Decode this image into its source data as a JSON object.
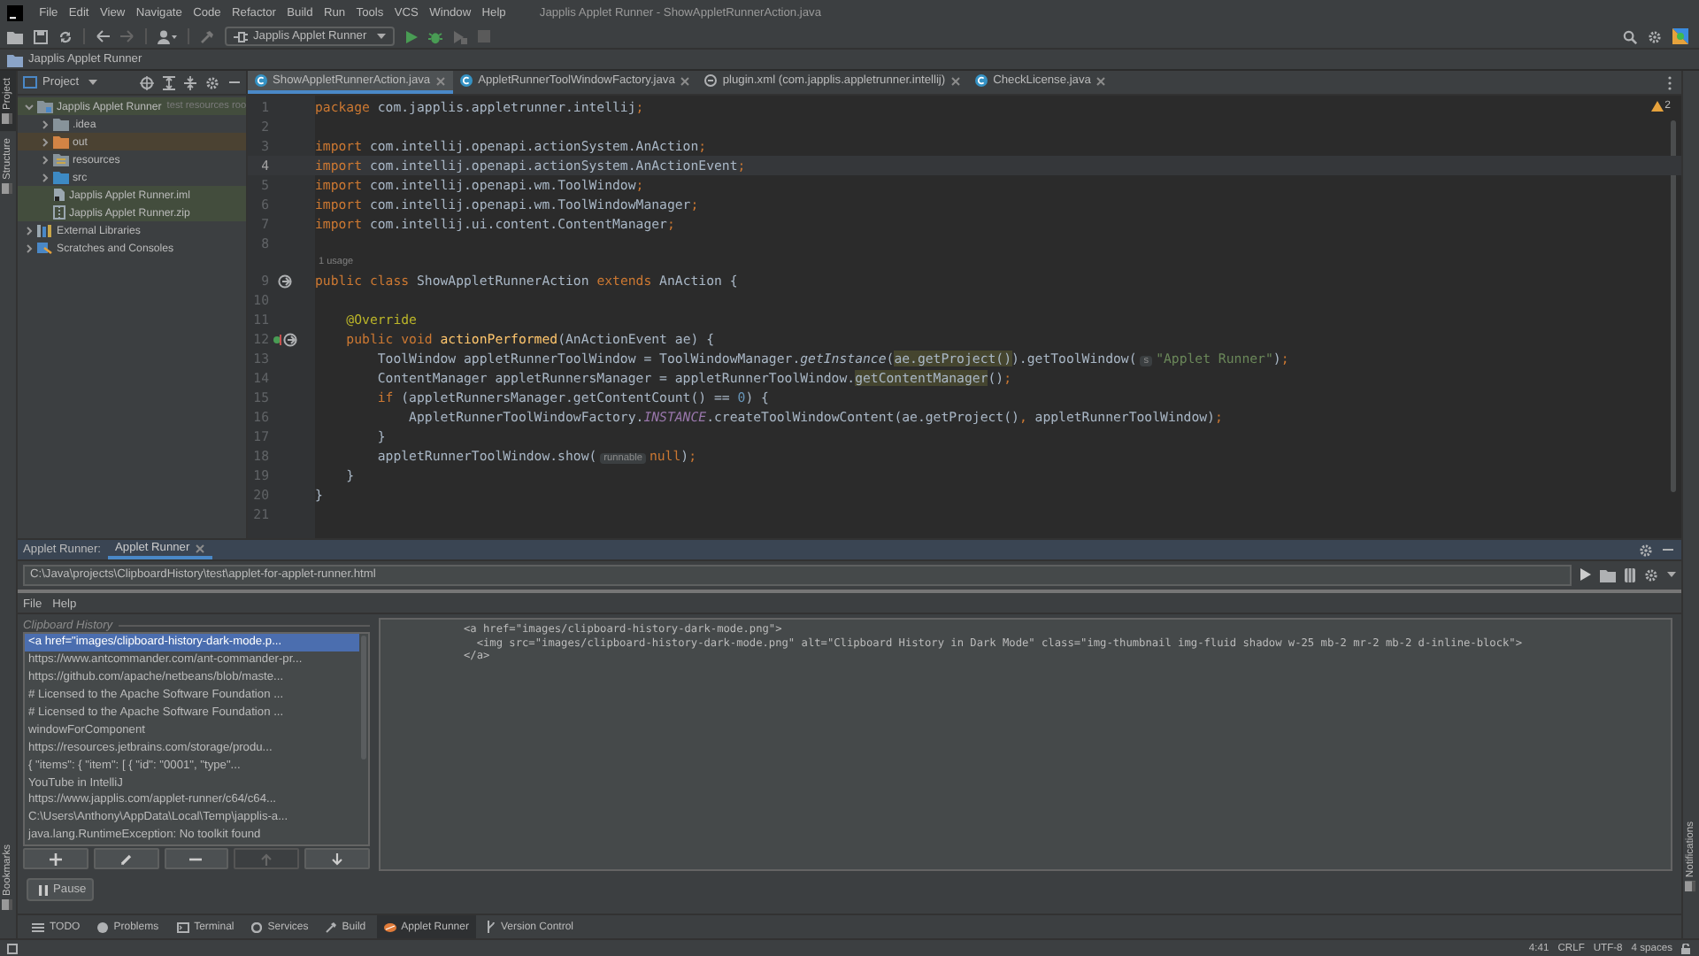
{
  "window": {
    "title": "Japplis Applet Runner - ShowAppletRunnerAction.java"
  },
  "menu": [
    "File",
    "Edit",
    "View",
    "Navigate",
    "Code",
    "Refactor",
    "Build",
    "Run",
    "Tools",
    "VCS",
    "Window",
    "Help"
  ],
  "toolbar": {
    "run_configuration": "Japplis Applet Runner"
  },
  "breadcrumb": "Japplis Applet Runner",
  "tool_stripe": {
    "left_top": [
      {
        "label": "Project",
        "selected": true
      },
      {
        "label": "Structure",
        "selected": false
      }
    ],
    "left_bottom": [
      {
        "label": "Bookmarks",
        "selected": false
      }
    ],
    "right_bottom": [
      {
        "label": "Notifications",
        "selected": false
      }
    ]
  },
  "project": {
    "title": "Project",
    "tree": [
      {
        "label": "Japplis Applet Runner",
        "note": "test resources roo",
        "kind": "module",
        "expanded": true,
        "color": "#434d3d",
        "children": [
          {
            "label": ".idea",
            "kind": "folder",
            "expanded": false
          },
          {
            "label": "out",
            "kind": "excluded-folder",
            "expanded": false,
            "color": "#4b4232"
          },
          {
            "label": "resources",
            "kind": "resources-folder",
            "expanded": false
          },
          {
            "label": "src",
            "kind": "source-folder",
            "expanded": false
          },
          {
            "label": "Japplis Applet Runner.iml",
            "kind": "iml-file",
            "color": "#434d3d"
          },
          {
            "label": "Japplis Applet Runner.zip",
            "kind": "zip-file",
            "color": "#434d3d"
          }
        ]
      },
      {
        "label": "External Libraries",
        "kind": "libraries",
        "expanded": false
      },
      {
        "label": "Scratches and Consoles",
        "kind": "scratches",
        "expanded": false
      }
    ]
  },
  "editor": {
    "tabs": [
      {
        "label": "ShowAppletRunnerAction.java",
        "kind": "java",
        "selected": true
      },
      {
        "label": "AppletRunnerToolWindowFactory.java",
        "kind": "java",
        "selected": false
      },
      {
        "label": "plugin.xml (com.japplis.appletrunner.intellij)",
        "kind": "xml",
        "selected": false
      },
      {
        "label": "CheckLicense.java",
        "kind": "java",
        "selected": false
      }
    ],
    "warning_count": "2",
    "lines": [
      {
        "number": "1",
        "kind": "code",
        "current": false,
        "tokens": [
          {
            "kind": "keyword",
            "text": "package"
          },
          {
            "kind": "plain",
            "text": " com.japplis.appletrunner.intellij"
          },
          {
            "kind": "keyword",
            "text": ";"
          }
        ]
      },
      {
        "number": "2",
        "kind": "code",
        "current": false
      },
      {
        "number": "3",
        "kind": "code",
        "current": false,
        "tokens": [
          {
            "kind": "keyword",
            "text": "import"
          },
          {
            "kind": "plain",
            "text": " com.intellij.openapi.actionSystem.AnAction"
          },
          {
            "kind": "keyword",
            "text": ";"
          }
        ]
      },
      {
        "number": "4",
        "kind": "code",
        "current": true,
        "tokens": [
          {
            "kind": "keyword",
            "text": "import"
          },
          {
            "kind": "plain",
            "text": " com.intellij.openapi.actionSystem.AnActionEvent"
          },
          {
            "kind": "keyword",
            "text": ";"
          }
        ]
      },
      {
        "number": "5",
        "kind": "code",
        "current": false,
        "tokens": [
          {
            "kind": "keyword",
            "text": "import"
          },
          {
            "kind": "plain",
            "text": " com.intellij.openapi.wm.ToolWindow"
          },
          {
            "kind": "keyword",
            "text": ";"
          }
        ]
      },
      {
        "number": "6",
        "kind": "code",
        "current": false,
        "tokens": [
          {
            "kind": "keyword",
            "text": "import"
          },
          {
            "kind": "plain",
            "text": " com.intellij.openapi.wm.ToolWindowManager"
          },
          {
            "kind": "keyword",
            "text": ";"
          }
        ]
      },
      {
        "number": "7",
        "kind": "code",
        "current": false,
        "tokens": [
          {
            "kind": "keyword",
            "text": "import"
          },
          {
            "kind": "plain",
            "text": " com.intellij.ui.content.ContentManager"
          },
          {
            "kind": "keyword",
            "text": ";"
          }
        ]
      },
      {
        "number": "8",
        "kind": "code",
        "current": false
      },
      {
        "number": "9",
        "kind": "class-declaration",
        "current": false,
        "usage": "1 usage",
        "tokens": [
          {
            "kind": "keyword",
            "text": "public class"
          },
          {
            "kind": "plain",
            "text": " ShowAppletRunnerAction "
          },
          {
            "kind": "keyword",
            "text": "extends"
          },
          {
            "kind": "plain",
            "text": " AnAction {"
          }
        ]
      },
      {
        "number": "10",
        "kind": "code",
        "current": false
      },
      {
        "number": "11",
        "kind": "code",
        "current": false,
        "tokens": [
          {
            "kind": "annotation",
            "text": "    @Override"
          }
        ]
      },
      {
        "number": "12",
        "kind": "override-method",
        "current": false,
        "tokens": [
          {
            "kind": "keyword",
            "text": "    public void "
          },
          {
            "kind": "method",
            "text": "actionPerformed"
          },
          {
            "kind": "plain",
            "text": "(AnActionEvent ae) {"
          }
        ]
      },
      {
        "number": "13",
        "kind": "code",
        "current": false,
        "tokens": [
          {
            "kind": "plain",
            "text": "        ToolWindow appletRunnerToolWindow = ToolWindowManager."
          },
          {
            "kind": "static",
            "text": "getInstance"
          },
          {
            "kind": "plain",
            "text": "("
          },
          {
            "kind": "usage",
            "text": "ae.getProject()"
          },
          {
            "kind": "plain",
            "text": ").getToolWindow("
          },
          {
            "kind": "hint",
            "text": "s"
          },
          {
            "kind": "string",
            "text": "\"Applet Runner\""
          },
          {
            "kind": "plain",
            "text": ")"
          },
          {
            "kind": "keyword",
            "text": ";"
          }
        ]
      },
      {
        "number": "14",
        "kind": "code",
        "current": false,
        "tokens": [
          {
            "kind": "plain",
            "text": "        ContentManager appletRunnersManager = appletRunnerToolWindow."
          },
          {
            "kind": "usage",
            "text": "getContentManager"
          },
          {
            "kind": "plain",
            "text": "()"
          },
          {
            "kind": "keyword",
            "text": ";"
          }
        ]
      },
      {
        "number": "15",
        "kind": "code",
        "current": false,
        "tokens": [
          {
            "kind": "keyword",
            "text": "        if"
          },
          {
            "kind": "plain",
            "text": " (appletRunnersManager.getContentCount() == "
          },
          {
            "kind": "number",
            "text": "0"
          },
          {
            "kind": "plain",
            "text": ") {"
          }
        ]
      },
      {
        "number": "16",
        "kind": "code",
        "current": false,
        "tokens": [
          {
            "kind": "plain",
            "text": "            AppletRunnerToolWindowFactory."
          },
          {
            "kind": "constant",
            "text": "INSTANCE"
          },
          {
            "kind": "plain",
            "text": ".createToolWindowContent(ae.getProject()"
          },
          {
            "kind": "keyword",
            "text": ","
          },
          {
            "kind": "plain",
            "text": " appletRunnerToolWindow)"
          },
          {
            "kind": "keyword",
            "text": ";"
          }
        ]
      },
      {
        "number": "17",
        "kind": "code",
        "current": false,
        "tokens": [
          {
            "kind": "plain",
            "text": "        }"
          }
        ]
      },
      {
        "number": "18",
        "kind": "code",
        "current": false,
        "tokens": [
          {
            "kind": "plain",
            "text": "        appletRunnerToolWindow.show("
          },
          {
            "kind": "hint",
            "text": "runnable"
          },
          {
            "kind": "keyword",
            "text": "null"
          },
          {
            "kind": "plain",
            "text": ")"
          },
          {
            "kind": "keyword",
            "text": ";"
          }
        ]
      },
      {
        "number": "19",
        "kind": "code",
        "current": false,
        "tokens": [
          {
            "kind": "plain",
            "text": "    }"
          }
        ]
      },
      {
        "number": "20",
        "kind": "code",
        "current": false,
        "tokens": [
          {
            "kind": "plain",
            "text": "}"
          }
        ]
      },
      {
        "number": "21",
        "kind": "code",
        "current": false
      }
    ]
  },
  "applet_runner": {
    "title": "Applet Runner:",
    "tabs": [
      {
        "label": "Applet Runner",
        "selected": true
      }
    ],
    "path": "C:\\Java\\projects\\ClipboardHistory\\test\\applet-for-applet-runner.html",
    "menu": [
      "File",
      "Help"
    ],
    "history_title": "Clipboard History",
    "history": [
      {
        "text": "<a href=\"images/clipboard-history-dark-mode.p...",
        "selected": true
      },
      {
        "text": "https://www.antcommander.com/ant-commander-pr...",
        "selected": false
      },
      {
        "text": "https://github.com/apache/netbeans/blob/maste...",
        "selected": false
      },
      {
        "text": "# Licensed to the Apache Software Foundation ...",
        "selected": false
      },
      {
        "text": "# Licensed to the Apache Software Foundation ...",
        "selected": false
      },
      {
        "text": "windowForComponent",
        "selected": false
      },
      {
        "text": "https://resources.jetbrains.com/storage/produ...",
        "selected": false
      },
      {
        "text": "{ \"items\": { \"item\": [ { \"id\": \"0001\", \"type\"...",
        "selected": false
      },
      {
        "text": "YouTube in IntelliJ",
        "selected": false
      },
      {
        "text": "https://www.japplis.com/applet-runner/c64/c64...",
        "selected": false
      },
      {
        "text": "C:\\Users\\Anthony\\AppData\\Local\\Temp\\japplis-a...",
        "selected": false
      },
      {
        "text": "java.lang.RuntimeException: No toolkit found",
        "selected": false
      }
    ],
    "buttons": [
      {
        "kind": "add",
        "disabled": false
      },
      {
        "kind": "edit",
        "disabled": false
      },
      {
        "kind": "remove",
        "disabled": false
      },
      {
        "kind": "move-up",
        "disabled": true
      },
      {
        "kind": "move-down",
        "disabled": false
      }
    ],
    "preview": [
      "<a href=\"images/clipboard-history-dark-mode.png\">",
      "  <img src=\"images/clipboard-history-dark-mode.png\" alt=\"Clipboard History in Dark Mode\" class=\"img-thumbnail img-fluid shadow w-25 mb-2 mr-2 mb-2 d-inline-block\">",
      "</a>"
    ],
    "pause": "Pause"
  },
  "tool_tabs": [
    {
      "label": "TODO",
      "kind": "todo",
      "selected": false
    },
    {
      "label": "Problems",
      "kind": "problems",
      "selected": false
    },
    {
      "label": "Terminal",
      "kind": "terminal",
      "selected": false
    },
    {
      "label": "Services",
      "kind": "services",
      "selected": false
    },
    {
      "label": "Build",
      "kind": "build",
      "selected": false
    },
    {
      "label": "Applet Runner",
      "kind": "applet-runner",
      "selected": true
    },
    {
      "label": "Version Control",
      "kind": "vcs",
      "selected": false
    }
  ],
  "status_bar": [
    "4:41",
    "CRLF",
    "UTF-8",
    "4 spaces"
  ]
}
